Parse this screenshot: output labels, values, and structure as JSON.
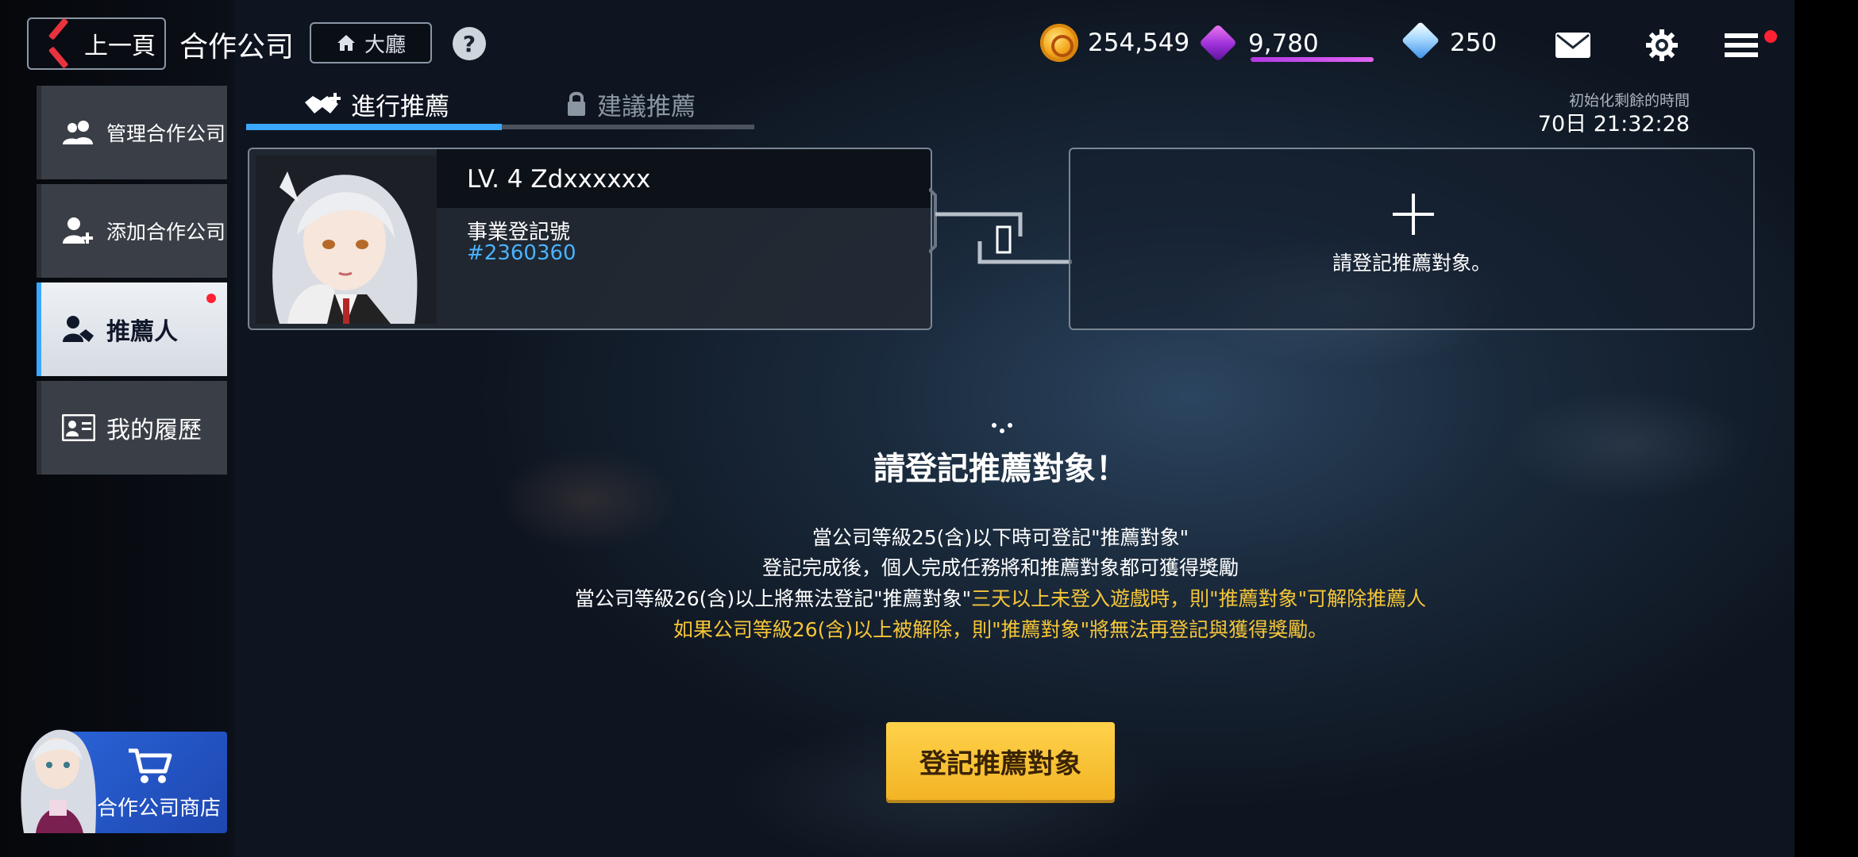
{
  "topbar": {
    "back_label": "上一頁",
    "title": "合作公司",
    "lobby_label": "大廳",
    "help_icon": "?",
    "gold": "254,549",
    "purple_gems": "9,780",
    "diamonds": "250"
  },
  "sidebar": {
    "items": [
      {
        "label": "管理合作公司",
        "icon": "users-icon"
      },
      {
        "label": "添加合作公司",
        "icon": "add-user-icon"
      },
      {
        "label": "推薦人",
        "icon": "handshake-user-icon"
      },
      {
        "label": "我的履歷",
        "icon": "profile-card-icon"
      }
    ],
    "shop_label": "合作公司商店"
  },
  "tabs": [
    {
      "label": "進行推薦",
      "active": true
    },
    {
      "label": "建議推薦",
      "locked": true
    }
  ],
  "timer": {
    "label": "初始化剩餘的時間",
    "value": "70日 21:32:28"
  },
  "card": {
    "name": "LV. 4 Zdxxxxxx",
    "reg_label": "事業登記號",
    "reg_value": "#2360360"
  },
  "target": {
    "label": "請登記推薦對象。"
  },
  "main": {
    "heading": "請登記推薦對象！",
    "line1": "當公司等級25(含)以下時可登記\"推薦對象\"",
    "line2": "登記完成後，個人完成任務將和推薦對象都可獲得獎勵",
    "line3_white": "當公司等級26(含)以上將無法登記\"推薦對象\"",
    "line3_yellow": "三天以上未登入遊戲時，則\"推薦對象\"可解除推薦人",
    "line4": "如果公司等級26(含)以上被解除，則\"推薦對象\"將無法再登記與獲得獎勵。",
    "register_button": "登記推薦對象"
  },
  "colors": {
    "accent_blue": "#3ba7ff",
    "highlight_yellow": "#f6c638",
    "button_yellow": "#f2b425",
    "notify_red": "#ff2233"
  }
}
